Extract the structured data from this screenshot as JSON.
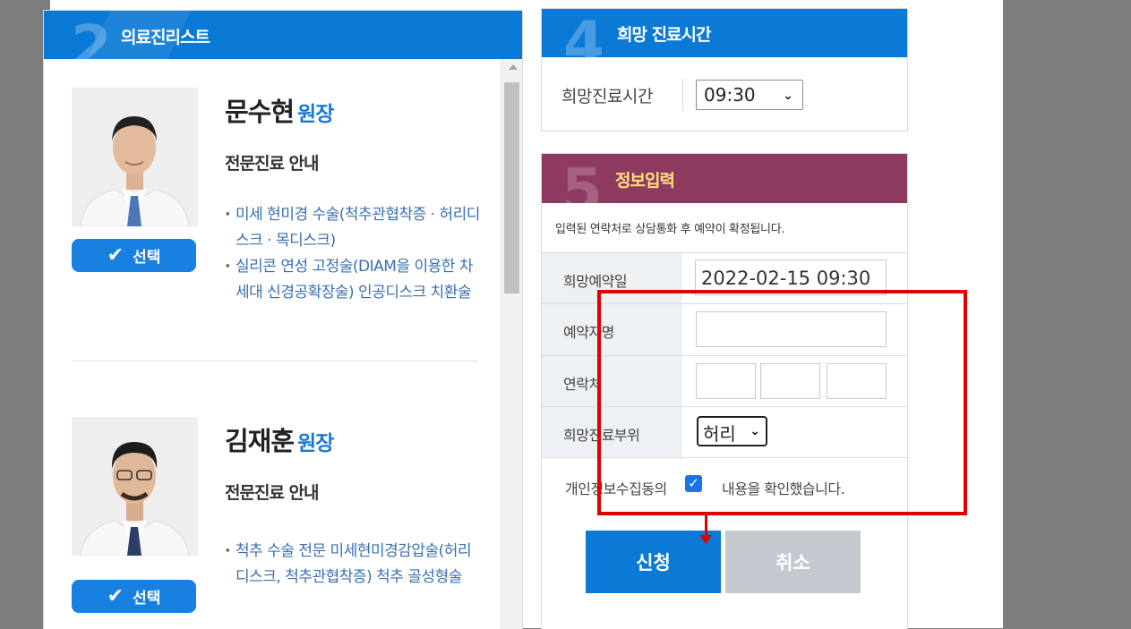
{
  "doctor_list": {
    "step_number": "2",
    "title": "의료진리스트",
    "select_label": "선택",
    "doctors": [
      {
        "name": "문수현",
        "title": "원장",
        "specialty_title": "전문진료 안내",
        "specialties": [
          "미세 현미경 수술(척추관협착증 · 허리디스크 · 목디스크)",
          "실리콘 연성 고정술(DIAM을 이용한 차세대 신경공확장술) 인공디스크 치환술"
        ]
      },
      {
        "name": "김재훈",
        "title": "원장",
        "specialty_title": "전문진료 안내",
        "specialties": [
          "척추 수술 전문 미세현미경감압술(허리디스크, 척추관협착증) 척추 골성형술"
        ]
      }
    ]
  },
  "time_panel": {
    "step_number": "4",
    "title": "희망 진료시간",
    "label": "희망진료시간",
    "selected_time": "09:30"
  },
  "info_panel": {
    "step_number": "5",
    "title": "정보입력",
    "notice": "입력된 연락처로 상담통화 후 예약이 확정됩니다.",
    "fields": {
      "date_label": "희망예약일",
      "date_value": "2022-02-15 09:30",
      "name_label": "예약자명",
      "name_value": "",
      "contact_label": "연락처",
      "part_label": "희망진료부위",
      "part_selected": "허리",
      "consent_label": "개인정보수집동의",
      "consent_text": "내용을 확인했습니다.",
      "consent_checked": true
    },
    "apply_label": "신청",
    "cancel_label": "취소"
  },
  "colors": {
    "primary_blue": "#0a7ad6",
    "info_header": "#8e3a61",
    "info_title": "#ffe27a",
    "annotation_red": "#e00000"
  }
}
